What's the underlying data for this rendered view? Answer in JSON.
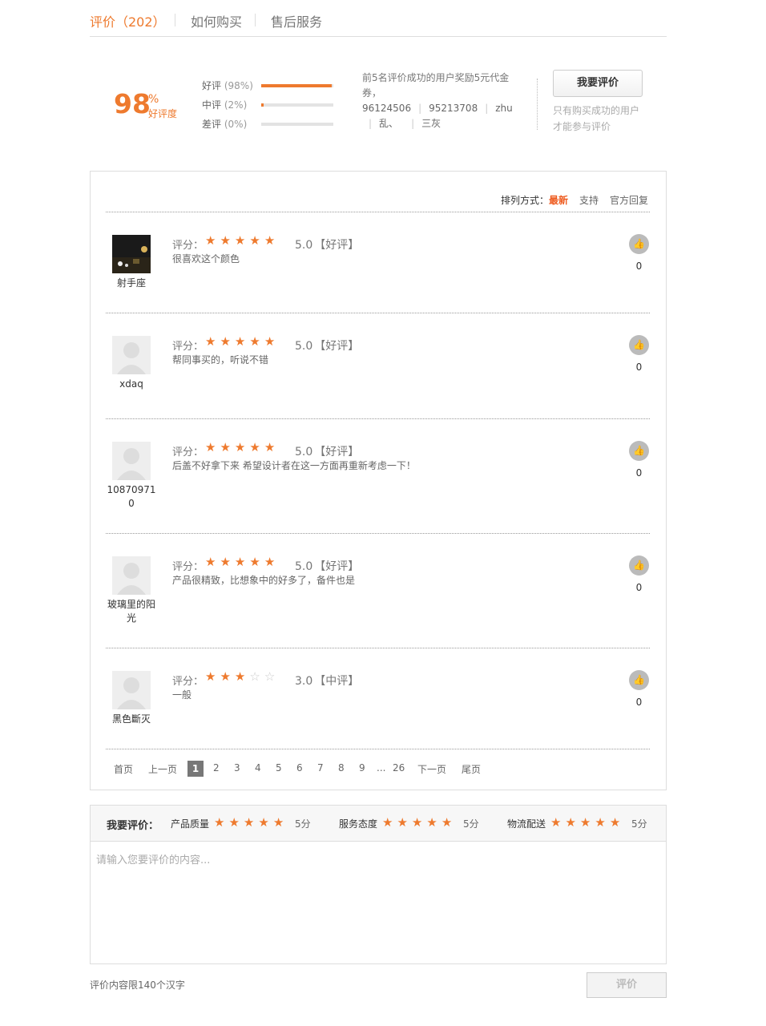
{
  "tabs": [
    {
      "label": "评价（202）"
    },
    {
      "label": "如何购买"
    },
    {
      "label": "售后服务"
    }
  ],
  "summary": {
    "percent": "98",
    "percent_sign": "%",
    "percent_label": "好评度",
    "rates": [
      {
        "label": "好评",
        "pct": "(98%)",
        "fill": 0.98
      },
      {
        "label": "中评",
        "pct": "(2%)",
        "fill": 0.02
      },
      {
        "label": "差评",
        "pct": "(0%)",
        "fill": 0
      }
    ],
    "reward_text": "前5名评价成功的用户奖励5元代金券，",
    "reward_users": [
      "96124506",
      "95213708",
      "zhu",
      "乱、",
      "三灰"
    ],
    "write_button": "我要评价",
    "write_hint_1": "只有购买成功的用户",
    "write_hint_2": "才能参与评价"
  },
  "sort": {
    "label": "排列方式：",
    "options": [
      "最新",
      "支持",
      "官方回复"
    ]
  },
  "reviews": [
    {
      "user": "射手座",
      "score_label": "评分：",
      "stars": 5,
      "score": "5.0",
      "tag": "【好评】",
      "text": "很喜欢这个颜色",
      "likes": "0",
      "avatar": "photo"
    },
    {
      "user": "xdaq",
      "score_label": "评分：",
      "stars": 5,
      "score": "5.0",
      "tag": "【好评】",
      "text": "帮同事买的，听说不错",
      "likes": "0",
      "avatar": "default"
    },
    {
      "user": "108709710",
      "score_label": "评分：",
      "stars": 5,
      "score": "5.0",
      "tag": "【好评】",
      "text": "后盖不好拿下来 希望设计者在这一方面再重新考虑一下！",
      "likes": "0",
      "avatar": "default"
    },
    {
      "user": "玻璃里的阳光",
      "score_label": "评分：",
      "stars": 5,
      "score": "5.0",
      "tag": "【好评】",
      "text": "产品很精致，比想象中的好多了，备件也是",
      "likes": "0",
      "avatar": "default"
    },
    {
      "user": "黑色斷灭",
      "score_label": "评分：",
      "stars": 3,
      "score": "3.0",
      "tag": "【中评】",
      "text": "一般",
      "likes": "0",
      "avatar": "default"
    }
  ],
  "pagination": {
    "first": "首页",
    "prev": "上一页",
    "pages": [
      "1",
      "2",
      "3",
      "4",
      "5",
      "6",
      "7",
      "8",
      "9"
    ],
    "ellipsis": "...",
    "last_page": "26",
    "next": "下一页",
    "last": "尾页",
    "current": "1"
  },
  "write": {
    "title": "我要评价：",
    "categories": [
      {
        "label": "产品质量",
        "value": "5分"
      },
      {
        "label": "服务态度",
        "value": "5分"
      },
      {
        "label": "物流配送",
        "value": "5分"
      }
    ],
    "placeholder": "请输入您要评价的内容...",
    "limit": "评价内容限140个汉字",
    "submit": "评价"
  },
  "colors": {
    "accent": "#ee7a2e",
    "sort_active": "#ee5a1e"
  },
  "icons": {
    "star": "star-icon",
    "like": "thumbs-up-icon",
    "avatar": "default-avatar-icon"
  }
}
